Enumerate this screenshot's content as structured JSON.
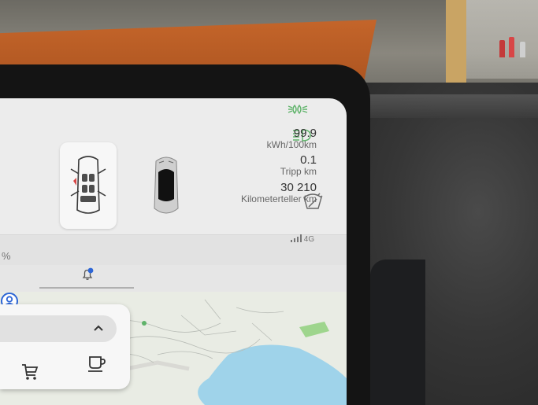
{
  "trip": {
    "consumption_value": "99.9",
    "consumption_unit": "kWh/100km",
    "trip_value": "0.1",
    "trip_label": "Tripp km",
    "odometer_value": "30 210",
    "odometer_label": "Kilometerteller km"
  },
  "status": {
    "signal_label": "4G",
    "percent_fragment": "%"
  },
  "colors": {
    "accent_green": "#5fb36a",
    "accent_blue": "#2d66d6",
    "water_blue": "#9fd3ea",
    "orange_card": "#b85b25"
  },
  "icons": [
    "parking-lights-icon",
    "headlights-icon",
    "car-doors-icon",
    "car-top-view-icon",
    "wiper-icon",
    "signal-bars-icon",
    "notification-bell-icon",
    "driver-profile-icon",
    "chevron-up-icon",
    "shopping-cart-icon",
    "coffee-cup-icon"
  ]
}
